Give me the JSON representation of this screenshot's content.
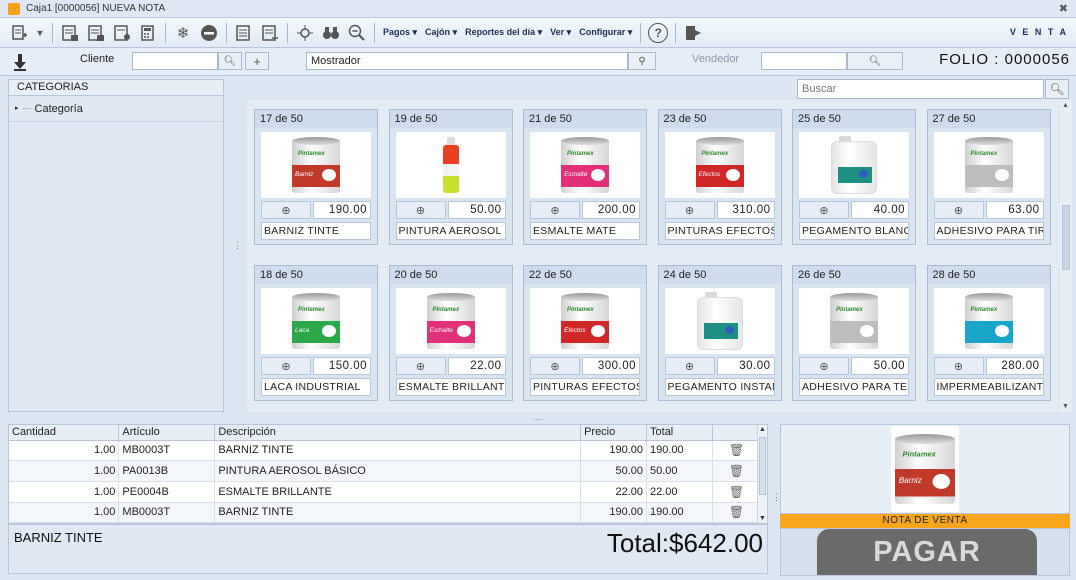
{
  "window": {
    "title": "Caja1 [0000056] NUEVA NOTA",
    "close_glyph": "✖"
  },
  "toolbar": {
    "menus": [
      "Pagos",
      "Cajón",
      "Reportes del día",
      "Ver",
      "Configurar"
    ],
    "mode": "V E N T A",
    "icons": [
      "new-note-icon",
      "new-note-dropdown-icon",
      "list-icon",
      "list-icon",
      "list-icon",
      "calculator-icon",
      "snowflake-icon",
      "remove-icon",
      "register-icon",
      "register-icon",
      "crosshair-icon",
      "binoculars-icon",
      "zoom-out-icon",
      "help-icon",
      "exit-icon"
    ]
  },
  "clientbar": {
    "cliente_label": "Cliente",
    "cliente_value": "",
    "mostrador_value": "Mostrador",
    "vendedor_label": "Vendedor",
    "vendedor_value": "",
    "folio": "FOLIO : 0000056"
  },
  "categories": {
    "header": "CATEGORIAS",
    "items": [
      "Categoría"
    ]
  },
  "search": {
    "placeholder": "Buscar"
  },
  "products": [
    {
      "stock": "17 de 50",
      "price": "190.00",
      "name": "BARNIZ TINTE",
      "img": "can",
      "color": "#c0392b",
      "label": "Barniz"
    },
    {
      "stock": "19 de 50",
      "price": "50.00",
      "name": "PINTURA AEROSOL BÁ",
      "img": "spray",
      "color": "#e84020",
      "label": ""
    },
    {
      "stock": "21 de 50",
      "price": "200.00",
      "name": "ESMALTE MATE",
      "img": "can",
      "color": "#e0307a",
      "label": "Esmalte"
    },
    {
      "stock": "23 de 50",
      "price": "310.00",
      "name": "PINTURAS EFECTOS F",
      "img": "can",
      "color": "#d02828",
      "label": "Efectos"
    },
    {
      "stock": "25 de 50",
      "price": "40.00",
      "name": "PEGAMENTO BLANCO",
      "img": "jug",
      "color": "#1e8f84",
      "label": ""
    },
    {
      "stock": "27 de 50",
      "price": "63.00",
      "name": "ADHESIVO PARA TIRC",
      "img": "can",
      "color": "#bdbdbd",
      "label": ""
    },
    {
      "stock": "18 de 50",
      "price": "150.00",
      "name": "LACA INDUSTRIAL",
      "img": "can",
      "color": "#2aa84a",
      "label": "Laca"
    },
    {
      "stock": "20 de 50",
      "price": "22.00",
      "name": "ESMALTE BRILLANTE",
      "img": "can",
      "color": "#e0307a",
      "label": "Esmalte"
    },
    {
      "stock": "22 de 50",
      "price": "300.00",
      "name": "PINTURAS EFECTOS C",
      "img": "can",
      "color": "#d02828",
      "label": "Efectos"
    },
    {
      "stock": "24 de 50",
      "price": "30.00",
      "name": "PEGAMENTO INSTANT",
      "img": "jug",
      "color": "#1e8f84",
      "label": ""
    },
    {
      "stock": "26 de 50",
      "price": "50.00",
      "name": "ADHESIVO PARA TEXT",
      "img": "can",
      "color": "#bdbdbd",
      "label": ""
    },
    {
      "stock": "28 de 50",
      "price": "280.00",
      "name": "IMPERMEABILIZANTE",
      "img": "can",
      "color": "#1aa6c8",
      "label": ""
    }
  ],
  "brand_text": "Pintamex",
  "table": {
    "headers": [
      "Cantidad",
      "Artículo",
      "Descripción",
      "Precio",
      "Total"
    ],
    "rows": [
      {
        "qty": "1.00",
        "code": "MB0003T",
        "desc": "BARNIZ TINTE",
        "price": "190.00",
        "total": "190.00"
      },
      {
        "qty": "1.00",
        "code": "PA0013B",
        "desc": "PINTURA AEROSOL BÁSICO",
        "price": "50.00",
        "total": "50.00"
      },
      {
        "qty": "1.00",
        "code": "PE0004B",
        "desc": "ESMALTE BRILLANTE",
        "price": "22.00",
        "total": "22.00"
      },
      {
        "qty": "1.00",
        "code": "MB0003T",
        "desc": "BARNIZ TINTE",
        "price": "190.00",
        "total": "190.00"
      }
    ]
  },
  "selected_item": "BARNIZ TINTE",
  "total": "Total:$642.00",
  "nota": "NOTA DE VENTA",
  "pagar": "PAGAR",
  "colors": {
    "accent_orange": "#f6a51c",
    "pagar_bg": "#6a6a6a",
    "panel_bg": "#dce6f2"
  }
}
